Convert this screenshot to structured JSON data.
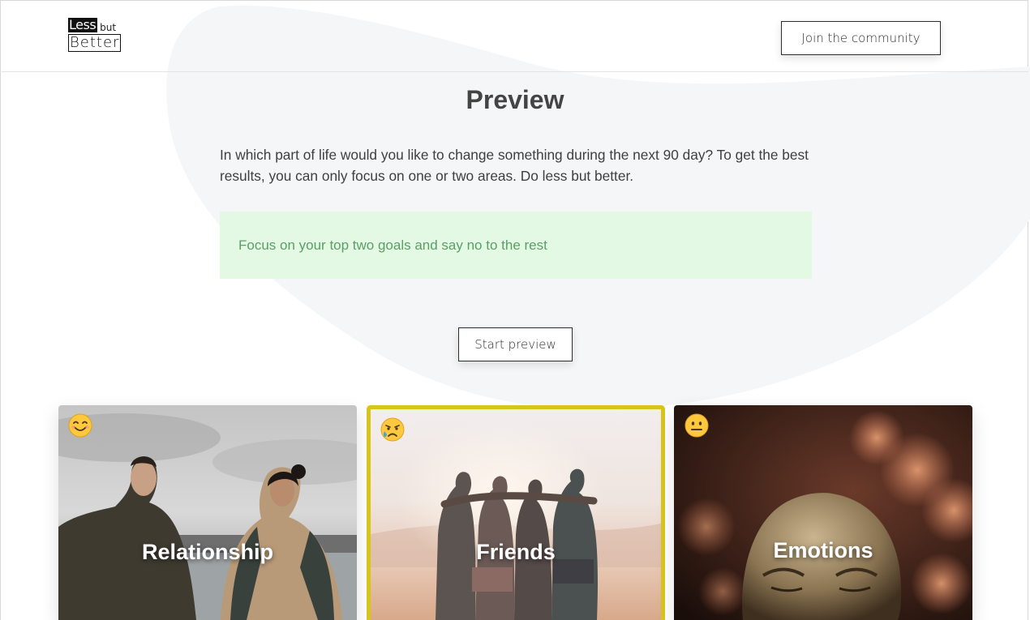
{
  "header": {
    "logo": {
      "word1": "Less",
      "word2": "but",
      "word3": "Better"
    },
    "join_label": "Join the community"
  },
  "main": {
    "title": "Preview",
    "intro": "In which part of life would you like to change something during the next 90 day? To get the best results, you can only focus on one or two areas. Do less but better.",
    "tip": "Focus on your top two goals and say no to the rest",
    "start_label": "Start preview"
  },
  "cards": [
    {
      "title": "Relationship",
      "mood": "smiling-face-icon",
      "selected": false
    },
    {
      "title": "Friends",
      "mood": "sad-face-icon",
      "selected": true
    },
    {
      "title": "Emotions",
      "mood": "neutral-face-icon",
      "selected": false
    }
  ],
  "colors": {
    "accent_border": "#d8c51c",
    "tip_bg": "#e4f9e3",
    "tip_text": "#5a9e68",
    "blob": "#f5f6f8"
  }
}
